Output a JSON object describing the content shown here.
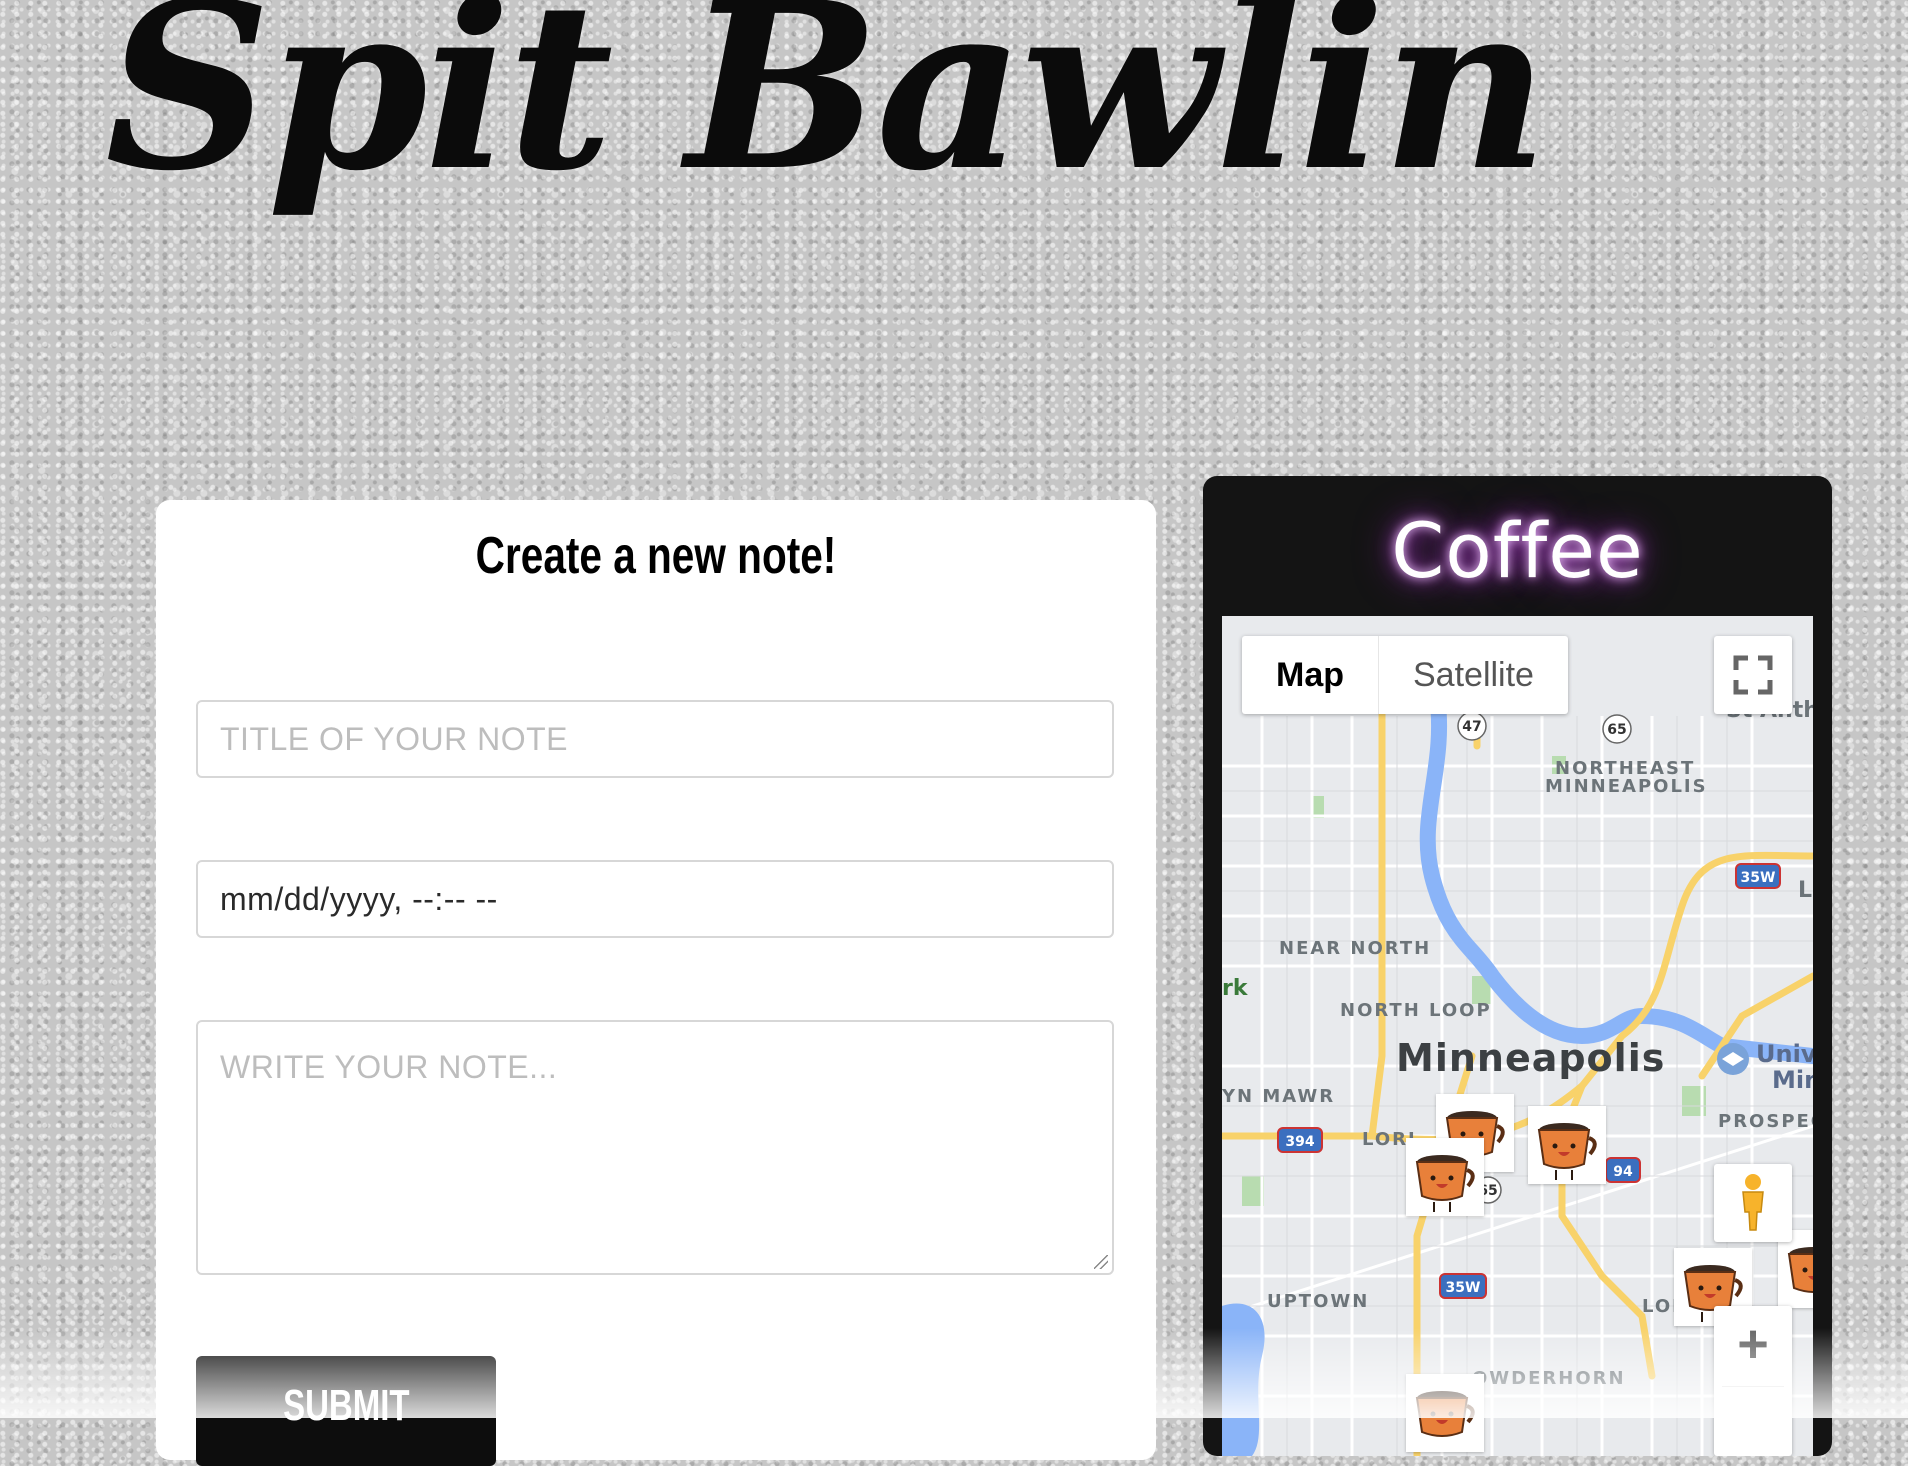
{
  "header": {
    "title": "Spit Bawlin"
  },
  "note_form": {
    "heading": "Create a new note!",
    "title_placeholder": "TITLE OF YOUR NOTE",
    "date_value": "mm/dd/yyyy, --:-- --",
    "note_placeholder": "WRITE YOUR NOTE...",
    "submit_label": "SUBMIT"
  },
  "coffee": {
    "title": "Coffee",
    "map": {
      "type_controls": [
        "Map",
        "Satellite"
      ],
      "active_type": "Map",
      "city": "Minneapolis",
      "neighborhoods": [
        "NORTHEAST",
        "MINNEAPOLIS",
        "NEAR NORTH",
        "NORTH LOOP",
        "YN MAWR",
        "LORI",
        "UPTOWN",
        "LON",
        "PROSPEC",
        "OWDERHORN",
        "Univ",
        "Min",
        "St Anth",
        "rk",
        "L"
      ],
      "highway_shields": [
        "47",
        "65",
        "35W",
        "394",
        "94",
        "65",
        "35W"
      ],
      "zoom_in_symbol": "+",
      "marker_icon": "coffee-cup-icon"
    }
  },
  "colors": {
    "note_card": "#ffffff",
    "coffee_card": "#141414",
    "neon_glow": "#b040d0",
    "submit_button": "#0d0d0d"
  }
}
